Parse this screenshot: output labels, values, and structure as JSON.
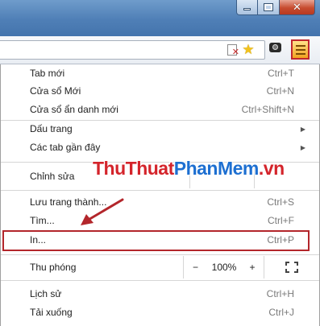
{
  "window": {
    "minimize_icon": "minimize-icon",
    "maximize_icon": "maximize-icon",
    "close_icon": "close-icon",
    "close_glyph": "✕"
  },
  "toolbar": {
    "page_icon": "page-blocked-icon",
    "star_icon": "bookmark-star-icon",
    "star_glyph": "★",
    "extension_icon": "camera-extension-icon",
    "menu_icon": "hamburger-menu-icon",
    "menu_highlight_color": "#c0272d"
  },
  "menu": {
    "new_tab": {
      "label": "Tab mới",
      "shortcut": "Ctrl+T"
    },
    "new_window": {
      "label": "Cửa sổ Mới",
      "shortcut": "Ctrl+N"
    },
    "incognito": {
      "label": "Cửa sổ ẩn danh mới",
      "shortcut": "Ctrl+Shift+N"
    },
    "bookmarks": {
      "label": "Dấu trang",
      "arrow": "▶"
    },
    "recent_tabs": {
      "label": "Các tab gần đây",
      "arrow": "▶"
    },
    "edit": {
      "label": "Chỉnh sửa"
    },
    "save_page": {
      "label": "Lưu trang thành...",
      "shortcut": "Ctrl+S"
    },
    "find": {
      "label": "Tìm...",
      "shortcut": "Ctrl+F"
    },
    "print": {
      "label": "In...",
      "shortcut": "Ctrl+P"
    },
    "zoom": {
      "label": "Thu phóng",
      "minus": "−",
      "level": "100%",
      "plus": "+",
      "fullscreen_icon": "fullscreen-icon"
    },
    "history": {
      "label": "Lịch sử",
      "shortcut": "Ctrl+H"
    },
    "downloads": {
      "label": "Tải xuống",
      "shortcut": "Ctrl+J"
    }
  },
  "overlay": {
    "watermark_part1": "ThuThuat",
    "watermark_part2": "PhanMem",
    "watermark_part3": ".vn",
    "watermark_red": "#d4242b",
    "watermark_blue": "#1d6fd1",
    "highlight_color": "#b3262b",
    "arrow_color": "#b3262b"
  }
}
